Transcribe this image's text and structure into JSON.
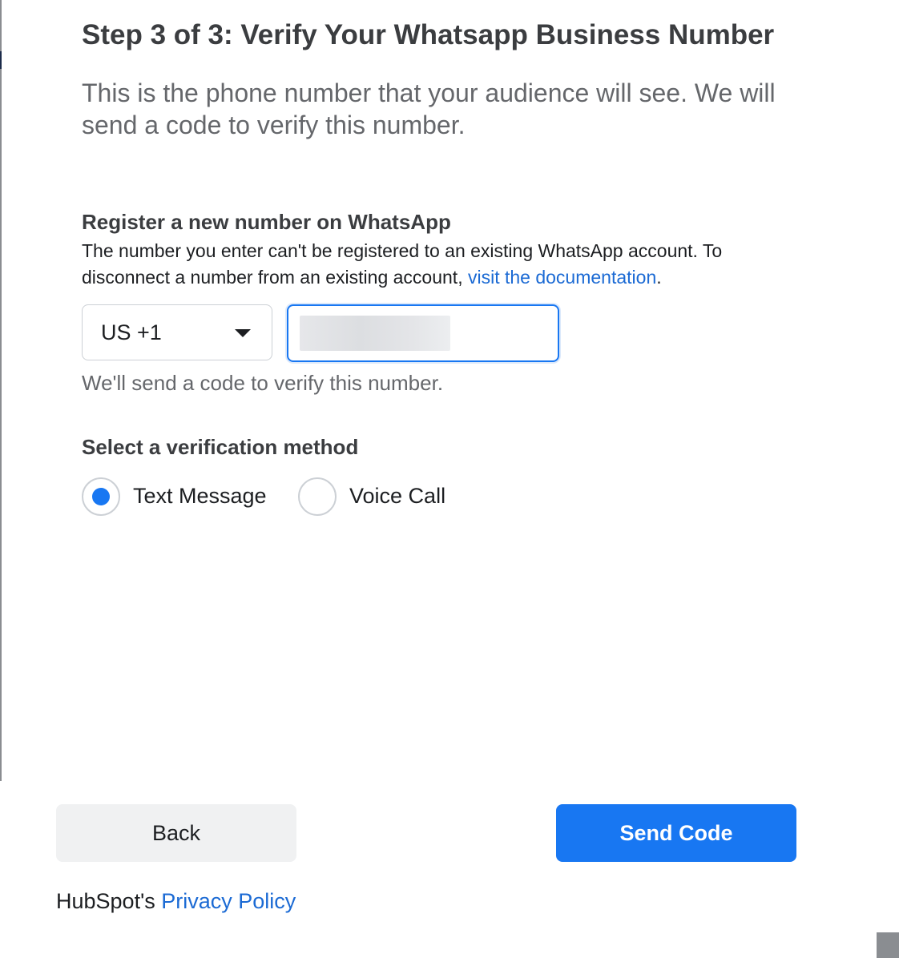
{
  "header": {
    "title": "Step 3 of 3: Verify Your Whatsapp Business Number",
    "subtitle": "This is the phone number that your audience will see. We will send a code to verify this number."
  },
  "register": {
    "heading": "Register a new number on WhatsApp",
    "description": "The number you enter can't be registered to an existing WhatsApp account. To disconnect a number from an existing account,",
    "link_text": "visit the documentation",
    "trailing": "."
  },
  "phone": {
    "country_code": "US +1",
    "number_value": "",
    "helper_text": "We'll send a code to verify this number."
  },
  "verification": {
    "heading": "Select a verification method",
    "options": [
      {
        "label": "Text Message",
        "selected": true
      },
      {
        "label": "Voice Call",
        "selected": false
      }
    ]
  },
  "actions": {
    "back_label": "Back",
    "send_label": "Send Code"
  },
  "footer": {
    "prefix": "HubSpot's ",
    "link_text": "Privacy Policy"
  },
  "colors": {
    "accent": "#1877f2",
    "link": "#1b6ad4",
    "muted_text": "#65676b"
  },
  "icons": {
    "country_dropdown": "caret-down-icon"
  }
}
